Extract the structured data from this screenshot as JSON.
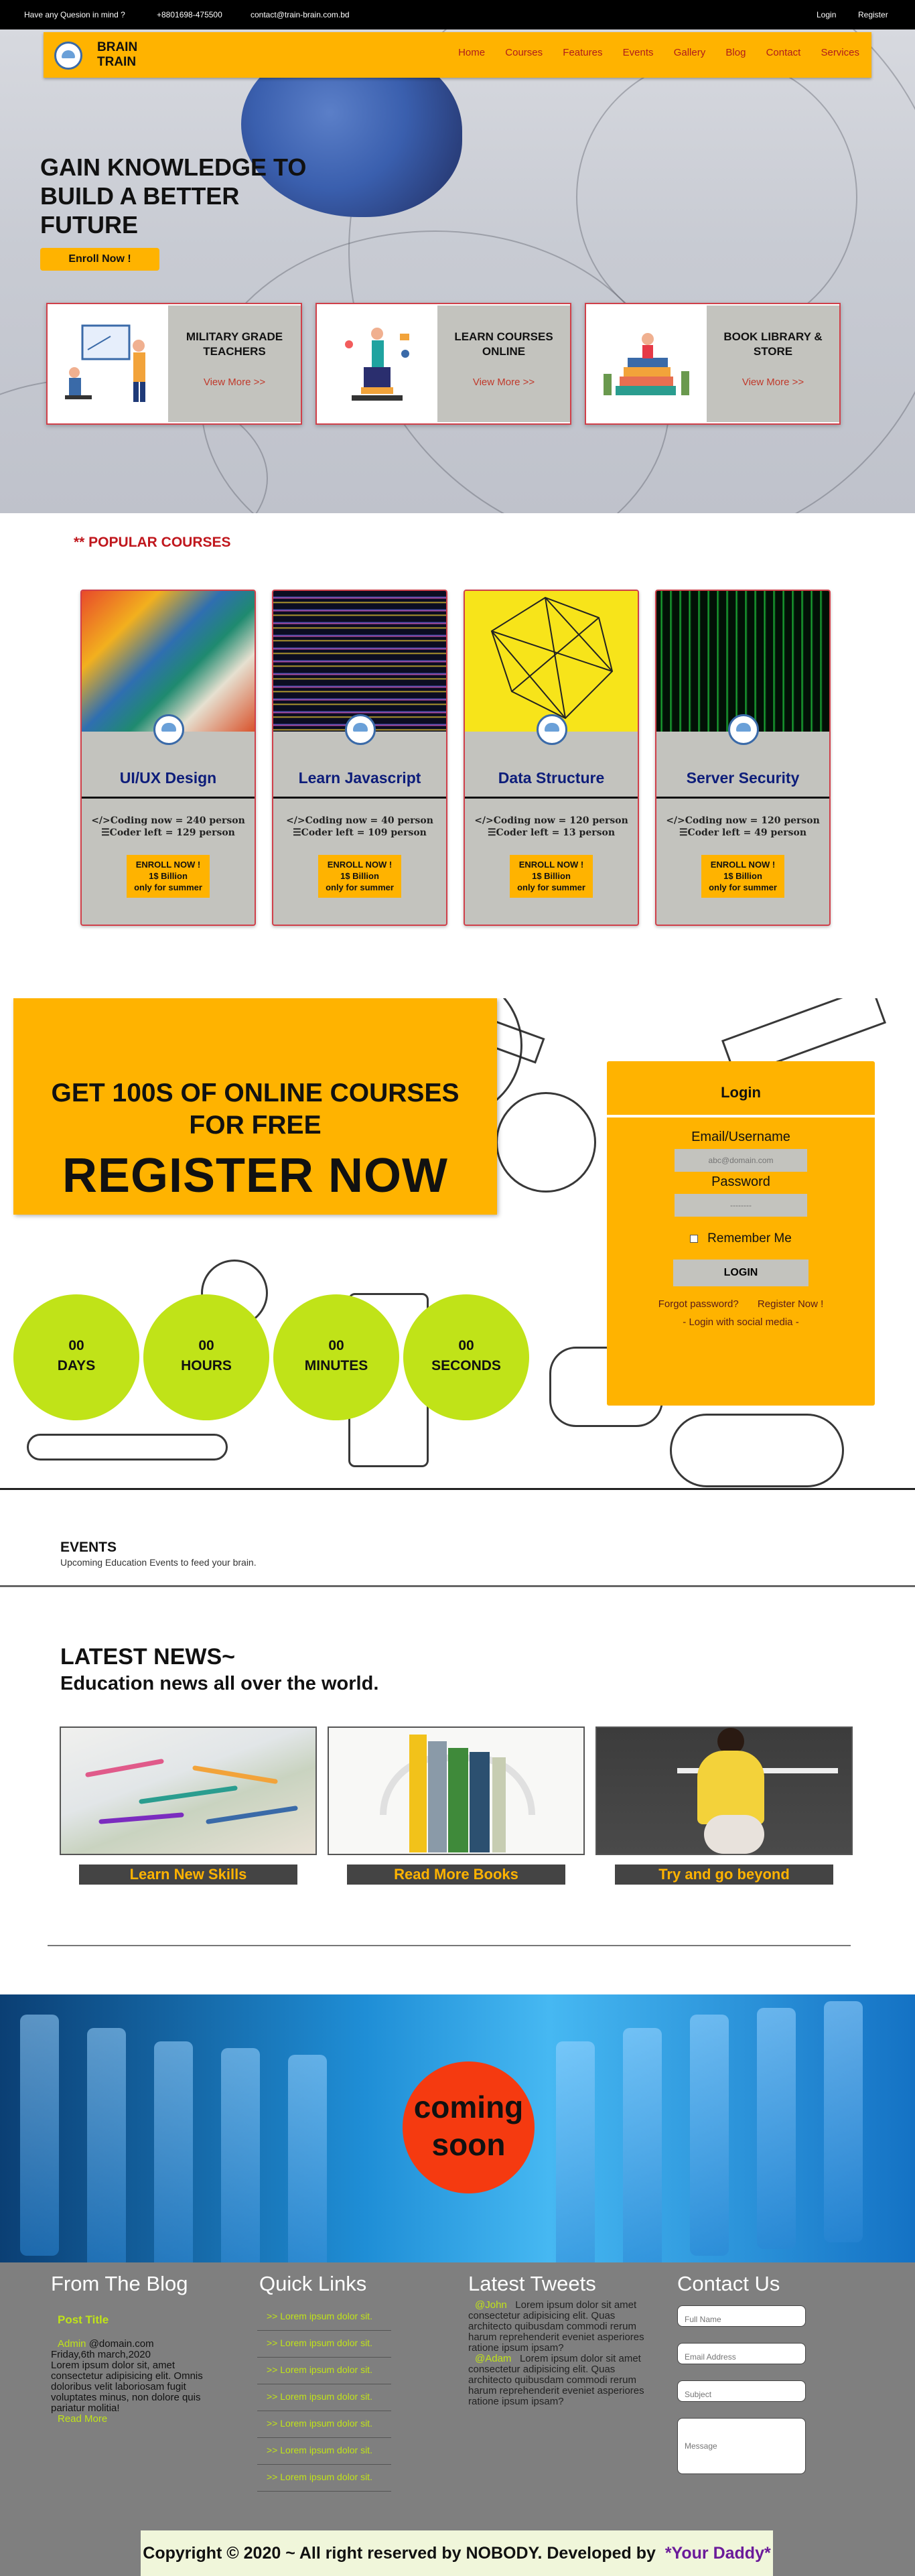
{
  "topbar": {
    "question": "Have any Quesion in mind ?",
    "phone": "+8801698-475500",
    "email": "contact@train-brain.com.bd",
    "login": "Login",
    "register": "Register"
  },
  "nav": {
    "brand_line1": "BRAIN",
    "brand_line2": "TRAIN",
    "items": [
      "Home",
      "Courses",
      "Features",
      "Events",
      "Gallery",
      "Blog",
      "Contact",
      "Services"
    ]
  },
  "hero": {
    "title": "GAIN KNOWLEDGE TO BUILD A BETTER FUTURE",
    "cta": "Enroll Now !",
    "cards": [
      {
        "title": "MILITARY GRADE TEACHERS",
        "link": "View More >>",
        "icon": "teacher-illustration"
      },
      {
        "title": "LEARN COURSES ONLINE",
        "link": "View More >>",
        "icon": "student-illustration"
      },
      {
        "title": "BOOK LIBRARY & STORE",
        "link": "View More >>",
        "icon": "books-illustration"
      }
    ]
  },
  "popular": {
    "title": "** POPULAR COURSES",
    "courses": [
      {
        "name": "UI/UX Design",
        "coding": "Coding now = 240 person",
        "left": "Coder left = 129 person",
        "cta1": "ENROLL NOW !",
        "cta2": "1$ Billion",
        "cta3": "only for summer"
      },
      {
        "name": "Learn Javascript",
        "coding": "Coding now = 40 person",
        "left": "Coder left = 109 person",
        "cta1": "ENROLL NOW !",
        "cta2": "1$ Billion",
        "cta3": "only for summer"
      },
      {
        "name": "Data Structure",
        "coding": "Coding now = 120 person",
        "left": "Coder left = 13 person",
        "cta1": "ENROLL NOW !",
        "cta2": "1$ Billion",
        "cta3": "only for summer"
      },
      {
        "name": "Server Security",
        "coding": "Coding now = 120 person",
        "left": "Coder left = 49 person",
        "cta1": "ENROLL NOW !",
        "cta2": "1$ Billion",
        "cta3": "only for summer"
      }
    ]
  },
  "register": {
    "line1": "GET 100S OF ONLINE COURSES",
    "line2": "FOR FREE",
    "line3": "REGISTER NOW",
    "countdown": [
      {
        "value": "00",
        "unit": "DAYS"
      },
      {
        "value": "00",
        "unit": "HOURS"
      },
      {
        "value": "00",
        "unit": "MINUTES"
      },
      {
        "value": "00",
        "unit": "SECONDS"
      }
    ]
  },
  "login": {
    "title": "Login",
    "user_label": "Email/Username",
    "user_placeholder": "abc@domain.com",
    "pass_label": "Password",
    "pass_placeholder": "--------",
    "remember": "Remember Me",
    "button": "LOGIN",
    "forgot": "Forgot password?",
    "register": "Register Now !",
    "social": "- Login with social media -"
  },
  "events": {
    "title": "EVENTS",
    "subtitle": "Upcoming Education Events to feed your brain."
  },
  "news": {
    "title": "LATEST NEWS~",
    "subtitle": "Education news all over the world.",
    "cards": [
      {
        "label": "Learn New Skills"
      },
      {
        "label": "Read More Books"
      },
      {
        "label": "Try and go beyond"
      }
    ]
  },
  "soon": {
    "line1": "coming",
    "line2": "soon"
  },
  "footer": {
    "blog": {
      "heading": "From The Blog",
      "post_title": "Post Title",
      "author": "Admin",
      "author_email": "@domain.com",
      "date": "Friday,6th march,2020",
      "body": "Lorem ipsum dolor sit, amet consectetur adipisicing elit. Omnis doloribus velit laboriosam fugit voluptates minus, non dolore quis pariatur molitia!",
      "read_more": "Read More"
    },
    "quick": {
      "heading": "Quick Links",
      "links": [
        ">> Lorem ipsum dolor sit.",
        ">> Lorem ipsum dolor sit.",
        ">> Lorem ipsum dolor sit.",
        ">> Lorem ipsum dolor sit.",
        ">> Lorem ipsum dolor sit.",
        ">> Lorem ipsum dolor sit.",
        ">> Lorem ipsum dolor sit."
      ]
    },
    "tweets": {
      "heading": "Latest Tweets",
      "items": [
        {
          "handle": "@John",
          "text": "Lorem ipsum dolor sit amet consectetur adipisicing elit. Quas architecto quibusdam commodi rerum harum reprehenderit eveniet asperiores ratione ipsum ipsam?"
        },
        {
          "handle": "@Adam",
          "text": "Lorem ipsum dolor sit amet consectetur adipisicing elit. Quas architecto quibusdam commodi rerum harum reprehenderit eveniet asperiores ratione ipsum ipsam?"
        }
      ]
    },
    "contact": {
      "heading": "Contact Us",
      "name_placeholder": "Full Name",
      "email_placeholder": "Email Address",
      "subject_placeholder": "Subject",
      "message_placeholder": "Message"
    },
    "copyright": "Copyright © 2020 ~ All right reserved by NOBODY. Developed by",
    "developer": "*Your Daddy*"
  },
  "colors": {
    "accent": "#ffb300",
    "lime": "#c0e318",
    "course_title": "#0d1d7a",
    "red": "#c0171d"
  }
}
